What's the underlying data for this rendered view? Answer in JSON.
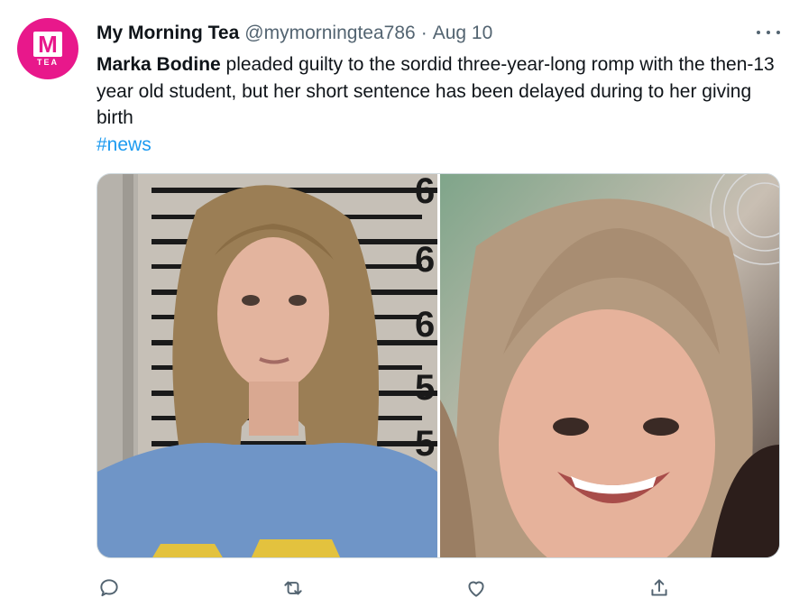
{
  "tweet": {
    "display_name": "My Morning Tea",
    "handle": "@mymorningtea786",
    "separator": "·",
    "date": "Aug 10",
    "avatar": {
      "letter": "M",
      "sub": "TEA",
      "color": "#e8188b"
    },
    "text_bold": "Marka Bodine",
    "text_rest": " pleaded guilty to the sordid three-year-long romp with the then-13 year old student, but her short sentence has been delayed during to her giving birth",
    "hashtag": "#news",
    "media": [
      {
        "description_icon": "photo-mugshot"
      },
      {
        "description_icon": "photo-selfie"
      }
    ],
    "mugshot_ruler_marks": [
      "6",
      "6",
      "6",
      "5",
      "5"
    ]
  },
  "actions": {
    "reply_icon": "reply-icon",
    "retweet_icon": "retweet-icon",
    "like_icon": "like-icon",
    "share_icon": "share-icon"
  },
  "colors": {
    "link": "#1d9bf0",
    "muted": "#536471",
    "text": "#0f1419"
  }
}
